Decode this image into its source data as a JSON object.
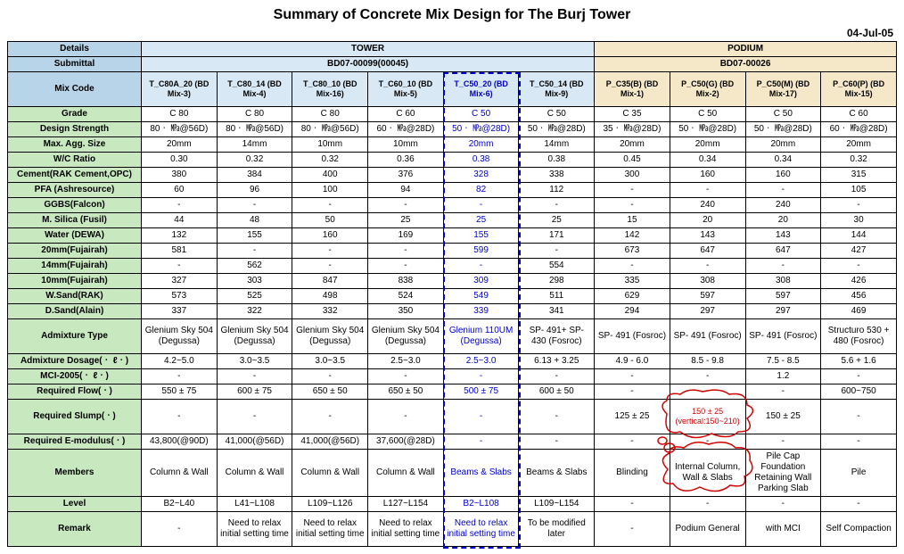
{
  "title": "Summary of Concrete Mix Design for The Burj Tower",
  "date": "04-Jul-05",
  "headers": {
    "details": "Details",
    "submittal": "Submittal",
    "mixcode": "Mix Code",
    "tower": "TOWER",
    "podium": "PODIUM",
    "tower_sub": "BD07-00099(00045)",
    "podium_sub": "BD07-00026"
  },
  "mixcodes": {
    "t1": "T_C80A_20 (BD Mix-3)",
    "t2": "T_C80_14 (BD Mix-4)",
    "t3": "T_C80_10 (BD Mix-16)",
    "t4": "T_C60_10 (BD Mix-5)",
    "t5": "T_C50_20 (BD Mix-6)",
    "t6": "T_C50_14 (BD Mix-9)",
    "p1": "P_C35(B) (BD Mix-1)",
    "p2": "P_C50(G) (BD Mix-2)",
    "p3": "P_C50(M) (BD Mix-17)",
    "p4": "P_C60(P) (BD Mix-15)"
  },
  "rows": {
    "grade": {
      "label": "Grade",
      "v": [
        "C 80",
        "C 80",
        "C 80",
        "C 60",
        "C 50",
        "C 50",
        "C 35",
        "C 50",
        "C 50",
        "C 60"
      ]
    },
    "design_strength": {
      "label": "Design Strength",
      "v": [
        "80ㆍ ㎫@56D)",
        "80ㆍ ㎫@56D)",
        "80ㆍ ㎫@56D)",
        "60ㆍ ㎫@28D)",
        "50ㆍ ㎫@28D)",
        "50ㆍ ㎫@28D)",
        "35ㆍ ㎫@28D)",
        "50ㆍ ㎫@28D)",
        "50ㆍ ㎫@28D)",
        "60ㆍ ㎫@28D)"
      ]
    },
    "max_agg": {
      "label": "Max. Agg. Size",
      "v": [
        "20mm",
        "14mm",
        "10mm",
        "10mm",
        "20mm",
        "14mm",
        "20mm",
        "20mm",
        "20mm",
        "20mm"
      ]
    },
    "wc": {
      "label": "W/C Ratio",
      "v": [
        "0.30",
        "0.32",
        "0.32",
        "0.36",
        "0.38",
        "0.38",
        "0.45",
        "0.34",
        "0.34",
        "0.32"
      ]
    },
    "cement": {
      "label": "Cement(RAK Cement,OPC)",
      "v": [
        "380",
        "384",
        "400",
        "376",
        "328",
        "338",
        "300",
        "160",
        "160",
        "315"
      ]
    },
    "pfa": {
      "label": "PFA (Ashresource)",
      "v": [
        "60",
        "96",
        "100",
        "94",
        "82",
        "112",
        "-",
        "-",
        "-",
        "105"
      ]
    },
    "ggbs": {
      "label": "GGBS(Falcon)",
      "v": [
        "-",
        "-",
        "-",
        "-",
        "-",
        "-",
        "-",
        "240",
        "240",
        "-"
      ]
    },
    "msilica": {
      "label": "M. Silica (Fusil)",
      "v": [
        "44",
        "48",
        "50",
        "25",
        "25",
        "25",
        "15",
        "20",
        "20",
        "30"
      ]
    },
    "water": {
      "label": "Water (DEWA)",
      "v": [
        "132",
        "155",
        "160",
        "169",
        "155",
        "171",
        "142",
        "143",
        "143",
        "144"
      ]
    },
    "agg20": {
      "label": "20mm(Fujairah)",
      "v": [
        "581",
        "-",
        "-",
        "-",
        "599",
        "-",
        "673",
        "647",
        "647",
        "427"
      ]
    },
    "agg14": {
      "label": "14mm(Fujairah)",
      "v": [
        "-",
        "562",
        "-",
        "-",
        "-",
        "554",
        "-",
        "-",
        "-",
        "-"
      ]
    },
    "agg10": {
      "label": "10mm(Fujairah)",
      "v": [
        "327",
        "303",
        "847",
        "838",
        "309",
        "298",
        "335",
        "308",
        "308",
        "426"
      ]
    },
    "wsand": {
      "label": "W.Sand(RAK)",
      "v": [
        "573",
        "525",
        "498",
        "524",
        "549",
        "511",
        "629",
        "597",
        "597",
        "456"
      ]
    },
    "dsand": {
      "label": "D.Sand(Alain)",
      "v": [
        "337",
        "322",
        "332",
        "350",
        "339",
        "341",
        "294",
        "297",
        "297",
        "469"
      ]
    },
    "admix_type": {
      "label": "Admixture Type",
      "v": [
        "Glenium Sky 504 (Degussa)",
        "Glenium Sky 504 (Degussa)",
        "Glenium Sky 504 (Degussa)",
        "Glenium Sky 504 (Degussa)",
        "Glenium 110UM (Degussa)",
        "SP- 491+ SP- 430 (Fosroc)",
        "SP- 491 (Fosroc)",
        "SP- 491 (Fosroc)",
        "SP- 491 (Fosroc)",
        "Structuro 530 + 480 (Fosroc)"
      ]
    },
    "admix_dose": {
      "label": "Admixture Dosage(ㆍ ℓㆍ)",
      "v": [
        "4.2~5.0",
        "3.0~3.5",
        "3.0~3.5",
        "2.5~3.0",
        "2.5~3.0",
        "6.13 + 3.25",
        "4.9 - 6.0",
        "8.5 - 9.8",
        "7.5 - 8.5",
        "5.6 + 1.6"
      ]
    },
    "mci": {
      "label": "MCI-2005(ㆍ ℓㆍ)",
      "v": [
        "-",
        "-",
        "-",
        "-",
        "-",
        "-",
        "-",
        "-",
        "1.2",
        "-"
      ]
    },
    "req_flow": {
      "label": "Required Flow(ㆍ)",
      "v": [
        "550 ± 75",
        "600 ± 75",
        "650 ± 50",
        "650 ± 50",
        "500 ± 75",
        "600 ± 50",
        "-",
        "-",
        "-",
        "600~750"
      ]
    },
    "req_slump": {
      "label": "Required Slump(ㆍ)",
      "v": [
        "-",
        "-",
        "-",
        "-",
        "-",
        "-",
        "125 ± 25",
        "150 ± 25 (vertical:150~210)",
        "150 ± 25",
        "-"
      ]
    },
    "req_emod": {
      "label": "Required E-modulus(ㆍ)",
      "v": [
        "43,800(@90D)",
        "41,000(@56D)",
        "41,000(@56D)",
        "37,600(@28D)",
        "-",
        "-",
        "-",
        "-",
        "-",
        "-"
      ]
    },
    "members": {
      "label": "Members",
      "v": [
        "Column & Wall",
        "Column & Wall",
        "Column & Wall",
        "Column & Wall",
        "Beams & Slabs",
        "Beams & Slabs",
        "Blinding",
        "Internal Column, Wall & Slabs",
        "Pile Cap Foundation Retaining Wall Parking Slab",
        "Pile"
      ]
    },
    "level": {
      "label": "Level",
      "v": [
        "B2~L40",
        "L41~L108",
        "L109~L126",
        "L127~L154",
        "B2~L108",
        "L109~L154",
        "-",
        "-",
        "-",
        "-"
      ]
    },
    "remark": {
      "label": "Remark",
      "v": [
        "-",
        "Need to relax initial setting time",
        "Need to relax initial setting time",
        "Need to relax initial setting time",
        "Need to relax initial setting time",
        "To be modified later",
        "-",
        "Podium General",
        "with MCI",
        "Self Compaction"
      ]
    }
  }
}
